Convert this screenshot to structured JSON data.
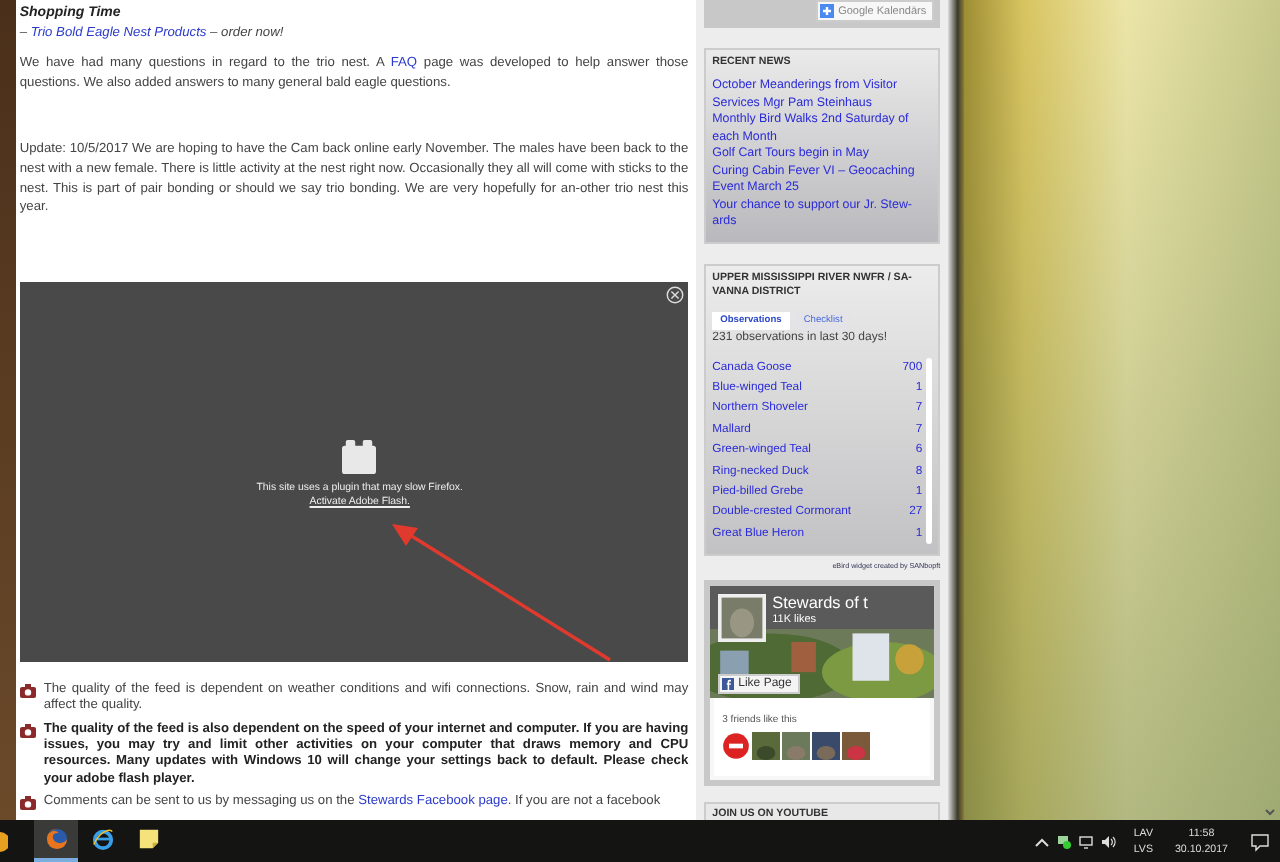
{
  "article": {
    "heading": "Shopping Time",
    "promo": [
      {
        "kind": "text",
        "text": "– "
      },
      {
        "kind": "link",
        "text": "Trio Bold Eagle Nest Products"
      },
      {
        "kind": "text",
        "text": " – order now!"
      }
    ],
    "paragraphs": [
      [
        {
          "kind": "text",
          "text": "We have had many questions in regard to the trio nest. A "
        },
        {
          "kind": "link",
          "text": "FAQ"
        },
        {
          "kind": "text",
          "text": " page was developed to help answer those questions.  We also added answers to many general bald eagle questions."
        }
      ],
      [
        {
          "kind": "text",
          "text": "Update: 10/5/2017  We are hoping to have the Cam back online early November. The males have been back to the nest with a new female. There is little activity at the nest right now. Occasionally they all will come with sticks to the nest. This is part of pair bonding or should we say trio bonding.  We are very hopefully for an-other trio nest this year."
        }
      ]
    ],
    "plugin": {
      "message": "This site uses a plugin that may slow Firefox.",
      "link": "Activate Adobe Flash."
    },
    "bullets": [
      {
        "bold": false,
        "parts": [
          {
            "kind": "text",
            "text": "The quality of the feed is dependent on weather conditions and wifi connections. Snow, rain and wind may affect the quality."
          }
        ]
      },
      {
        "bold": true,
        "parts": [
          {
            "kind": "text",
            "text": "The quality of the feed is also dependent on the speed of your internet and computer. If you are having issues, you may try and limit other activities on your computer that draws memory and CPU resources. Many updates with Windows 10 will change your settings back to default. Please check your adobe flash player."
          }
        ]
      },
      {
        "bold": false,
        "parts": [
          {
            "kind": "text",
            "text": "Comments can be sent to us by messaging us on the "
          },
          {
            "kind": "link",
            "text": "Stewards Facebook page"
          },
          {
            "kind": "text",
            "text": ".  If you are not a facebook"
          }
        ]
      }
    ]
  },
  "sidebar": {
    "calendar_button": "Google Kalendārs",
    "recent_news": {
      "title": "RECENT NEWS",
      "items": [
        "October Meanderings from Visitor Services Mgr Pam Steinhaus",
        "Monthly Bird Walks 2nd Saturday of each Month",
        "Golf Cart Tours begin in May",
        "Curing Cabin Fever VI – Geocaching Event March 25",
        "Your chance to support our Jr. Stew-ards"
      ]
    },
    "ebird": {
      "title": "UPPER MISSISSIPPI RIVER NWFR / SA-VANNA DISTRICT",
      "tabs": [
        {
          "label": "Observations",
          "selected": true
        },
        {
          "label": "Checklist",
          "selected": false
        }
      ],
      "summary": "231 observations in last 30 days!",
      "rows": [
        {
          "name": "Canada Goose",
          "count": "700"
        },
        {
          "name": "Blue-winged Teal",
          "count": "1"
        },
        {
          "name": "Northern Shoveler",
          "count": "7"
        },
        {
          "name": "Mallard",
          "count": "7"
        },
        {
          "name": "Green-winged Teal",
          "count": "6"
        },
        {
          "name": "Ring-necked Duck",
          "count": "8"
        },
        {
          "name": "Pied-billed Grebe",
          "count": "1"
        },
        {
          "name": "Double-crested Cormorant",
          "count": "27"
        },
        {
          "name": "Great Blue Heron",
          "count": "1"
        }
      ],
      "credit": "eBird widget created by SANbopft"
    },
    "facebook": {
      "page_name": "Stewards of t",
      "likes": "11K likes",
      "like_button": "Like Page",
      "friends": "3 friends like this"
    },
    "youtube_title": "JOIN US ON YOUTUBE"
  },
  "taskbar": {
    "apps": [
      {
        "kind": "fox",
        "active": true
      },
      {
        "kind": "ie",
        "active": false
      },
      {
        "kind": "notes",
        "active": false
      }
    ],
    "language": [
      "LAV",
      "LVS"
    ],
    "time": "11:58",
    "date": "30.10.2017"
  }
}
